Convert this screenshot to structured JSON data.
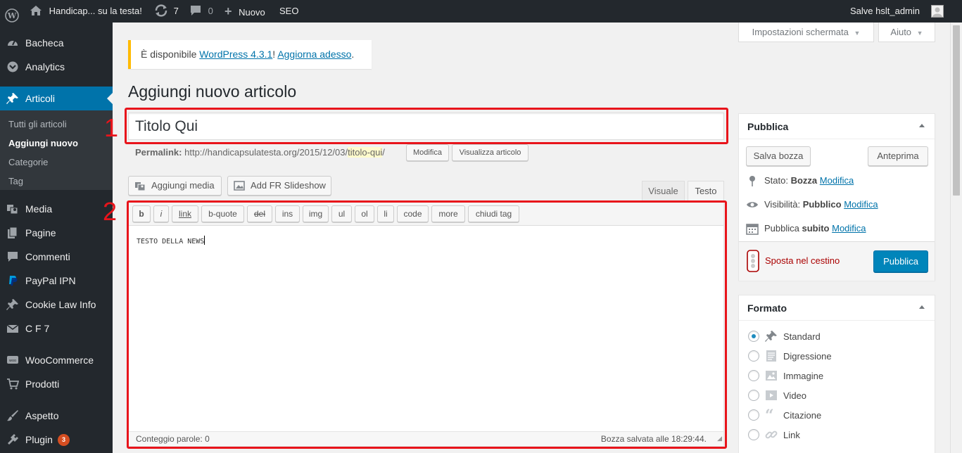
{
  "adminbar": {
    "site_name": "Handicap... su la testa!",
    "updates_count": "7",
    "comments_count": "0",
    "new_label": "Nuovo",
    "seo_label": "SEO",
    "greeting": "Salve hslt_admin"
  },
  "sidebar": {
    "items": [
      {
        "label": "Bacheca",
        "icon": "dashboard-icon"
      },
      {
        "label": "Analytics",
        "icon": "analytics-icon"
      },
      {
        "label": "Articoli",
        "icon": "pin-icon"
      },
      {
        "label": "Media",
        "icon": "media-icon"
      },
      {
        "label": "Pagine",
        "icon": "pages-icon"
      },
      {
        "label": "Commenti",
        "icon": "comments-icon"
      },
      {
        "label": "PayPal IPN",
        "icon": "paypal-icon"
      },
      {
        "label": "Cookie Law Info",
        "icon": "pin-icon"
      },
      {
        "label": "C F 7",
        "icon": "mail-icon"
      },
      {
        "label": "WooCommerce",
        "icon": "woo-icon"
      },
      {
        "label": "Prodotti",
        "icon": "cart-icon"
      },
      {
        "label": "Aspetto",
        "icon": "brush-icon"
      },
      {
        "label": "Plugin",
        "icon": "plugin-icon",
        "badge": "3"
      }
    ],
    "submenu": [
      "Tutti gli articoli",
      "Aggiungi nuovo",
      "Categorie",
      "Tag"
    ]
  },
  "screen_options": "Impostazioni schermata",
  "help": "Aiuto",
  "notice": {
    "prefix": "È disponibile ",
    "link1": "WordPress 4.3.1",
    "middle": "! ",
    "link2": "Aggiorna adesso",
    "suffix": "."
  },
  "page_title": "Aggiungi nuovo articolo",
  "post_title": "Titolo Qui",
  "annotations": [
    "1",
    "2"
  ],
  "permalink": {
    "label": "Permalink:",
    "base": "http://handicapsulatesta.org/2015/12/03/",
    "slug": "titolo-qui",
    "trail": "/",
    "edit_button": "Modifica",
    "view_button": "Visualizza articolo"
  },
  "media_buttons": {
    "add_media": "Aggiungi media",
    "add_slideshow": "Add FR Slideshow"
  },
  "editor_tabs": {
    "visual": "Visuale",
    "text": "Testo"
  },
  "quicktags": [
    "b",
    "i",
    "link",
    "b-quote",
    "del",
    "ins",
    "img",
    "ul",
    "ol",
    "li",
    "code",
    "more",
    "chiudi tag"
  ],
  "editor_content": "TESTO DELLA NEWS",
  "status": {
    "word_count": "Conteggio parole: 0",
    "draft_saved": "Bozza salvata alle 18:29:44."
  },
  "publish_box": {
    "title": "Pubblica",
    "save_draft": "Salva bozza",
    "preview": "Anteprima",
    "status_label": "Stato:",
    "status_value": "Bozza",
    "visibility_label": "Visibilità:",
    "visibility_value": "Pubblico",
    "publish_label": "Pubblica",
    "publish_value": "subito",
    "edit_link": "Modifica",
    "trash": "Sposta nel cestino",
    "publish_button": "Pubblica"
  },
  "format_box": {
    "title": "Formato",
    "options": [
      {
        "label": "Standard",
        "checked": true
      },
      {
        "label": "Digressione",
        "checked": false
      },
      {
        "label": "Immagine",
        "checked": false
      },
      {
        "label": "Video",
        "checked": false
      },
      {
        "label": "Citazione",
        "checked": false
      },
      {
        "label": "Link",
        "checked": false
      }
    ]
  },
  "colors": {
    "admin_dark": "#23282d",
    "accent": "#0073aa",
    "publish_blue": "#0085ba",
    "annotation_red": "#e8141b",
    "notice_yellow": "#ffba00"
  }
}
